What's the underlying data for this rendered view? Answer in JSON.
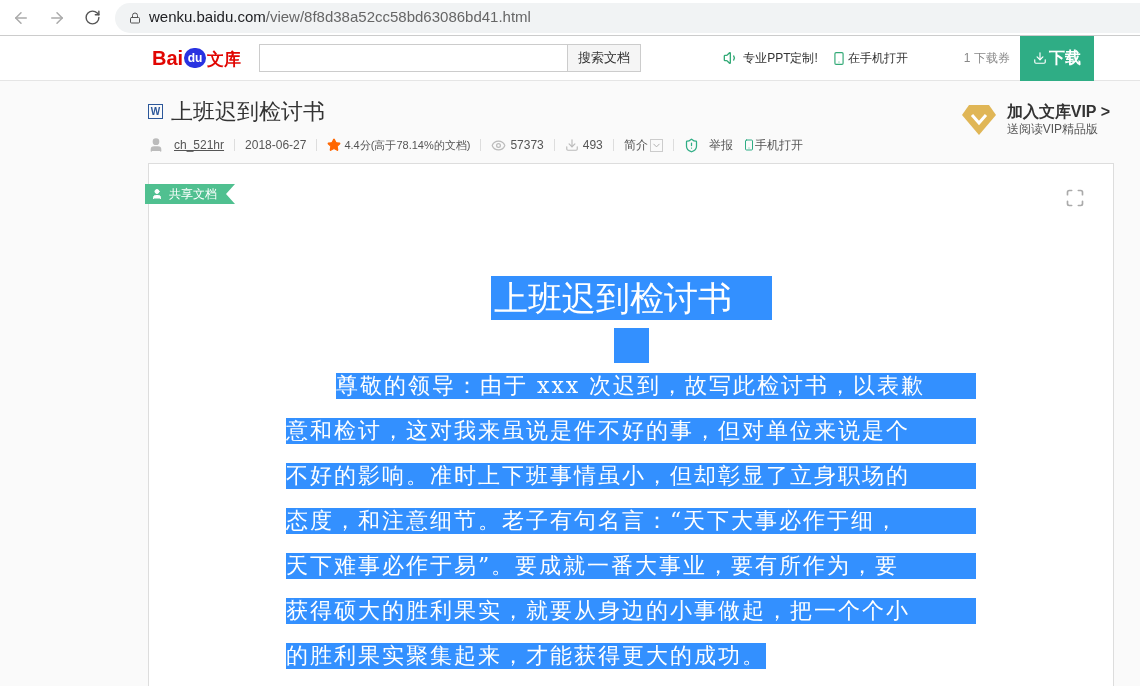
{
  "browser": {
    "url_host": "wenku.baidu.com",
    "url_path": "/view/8f8d38a52cc58bd63086bd41.html"
  },
  "header": {
    "logo_latin": "Bai",
    "logo_badge": "du",
    "logo_cn": "文库",
    "search_button": "搜索文档",
    "ppt_link": "专业PPT定制!",
    "phone_link": "在手机打开",
    "coupon": "1 下载券",
    "download_button": "下载"
  },
  "doc_meta": {
    "file_icon_letter": "W",
    "title": "上班迟到检讨书",
    "author": "ch_521hr",
    "date": "2018-06-27",
    "rating": "4.4分(高于78.14%的文档)",
    "views": "57373",
    "downloads": "493",
    "intro": "简介",
    "report": "举报",
    "mobile": "手机打开"
  },
  "vip": {
    "title": "加入文库VIP >",
    "subtitle": "送阅读VIP精品版"
  },
  "shared_tag": "共享文档",
  "document": {
    "selected": true,
    "title": "上班迟到检讨书",
    "lines": [
      "尊敬的领导：由于 xxx 次迟到，故写此检讨书，以表歉",
      "意和检讨，这对我来虽说是件不好的事，但对单位来说是个",
      "不好的影响。准时上下班事情虽小，但却彰显了立身职场的",
      "态度，和注意细节。老子有句名言：“天下大事必作于细，",
      "天下难事必作于易”。要成就一番大事业，要有所作为，要",
      "获得硕大的胜利果实，就要从身边的小事做起，把一个个小",
      "的胜利果实聚集起来，才能获得更大的成功。"
    ]
  }
}
